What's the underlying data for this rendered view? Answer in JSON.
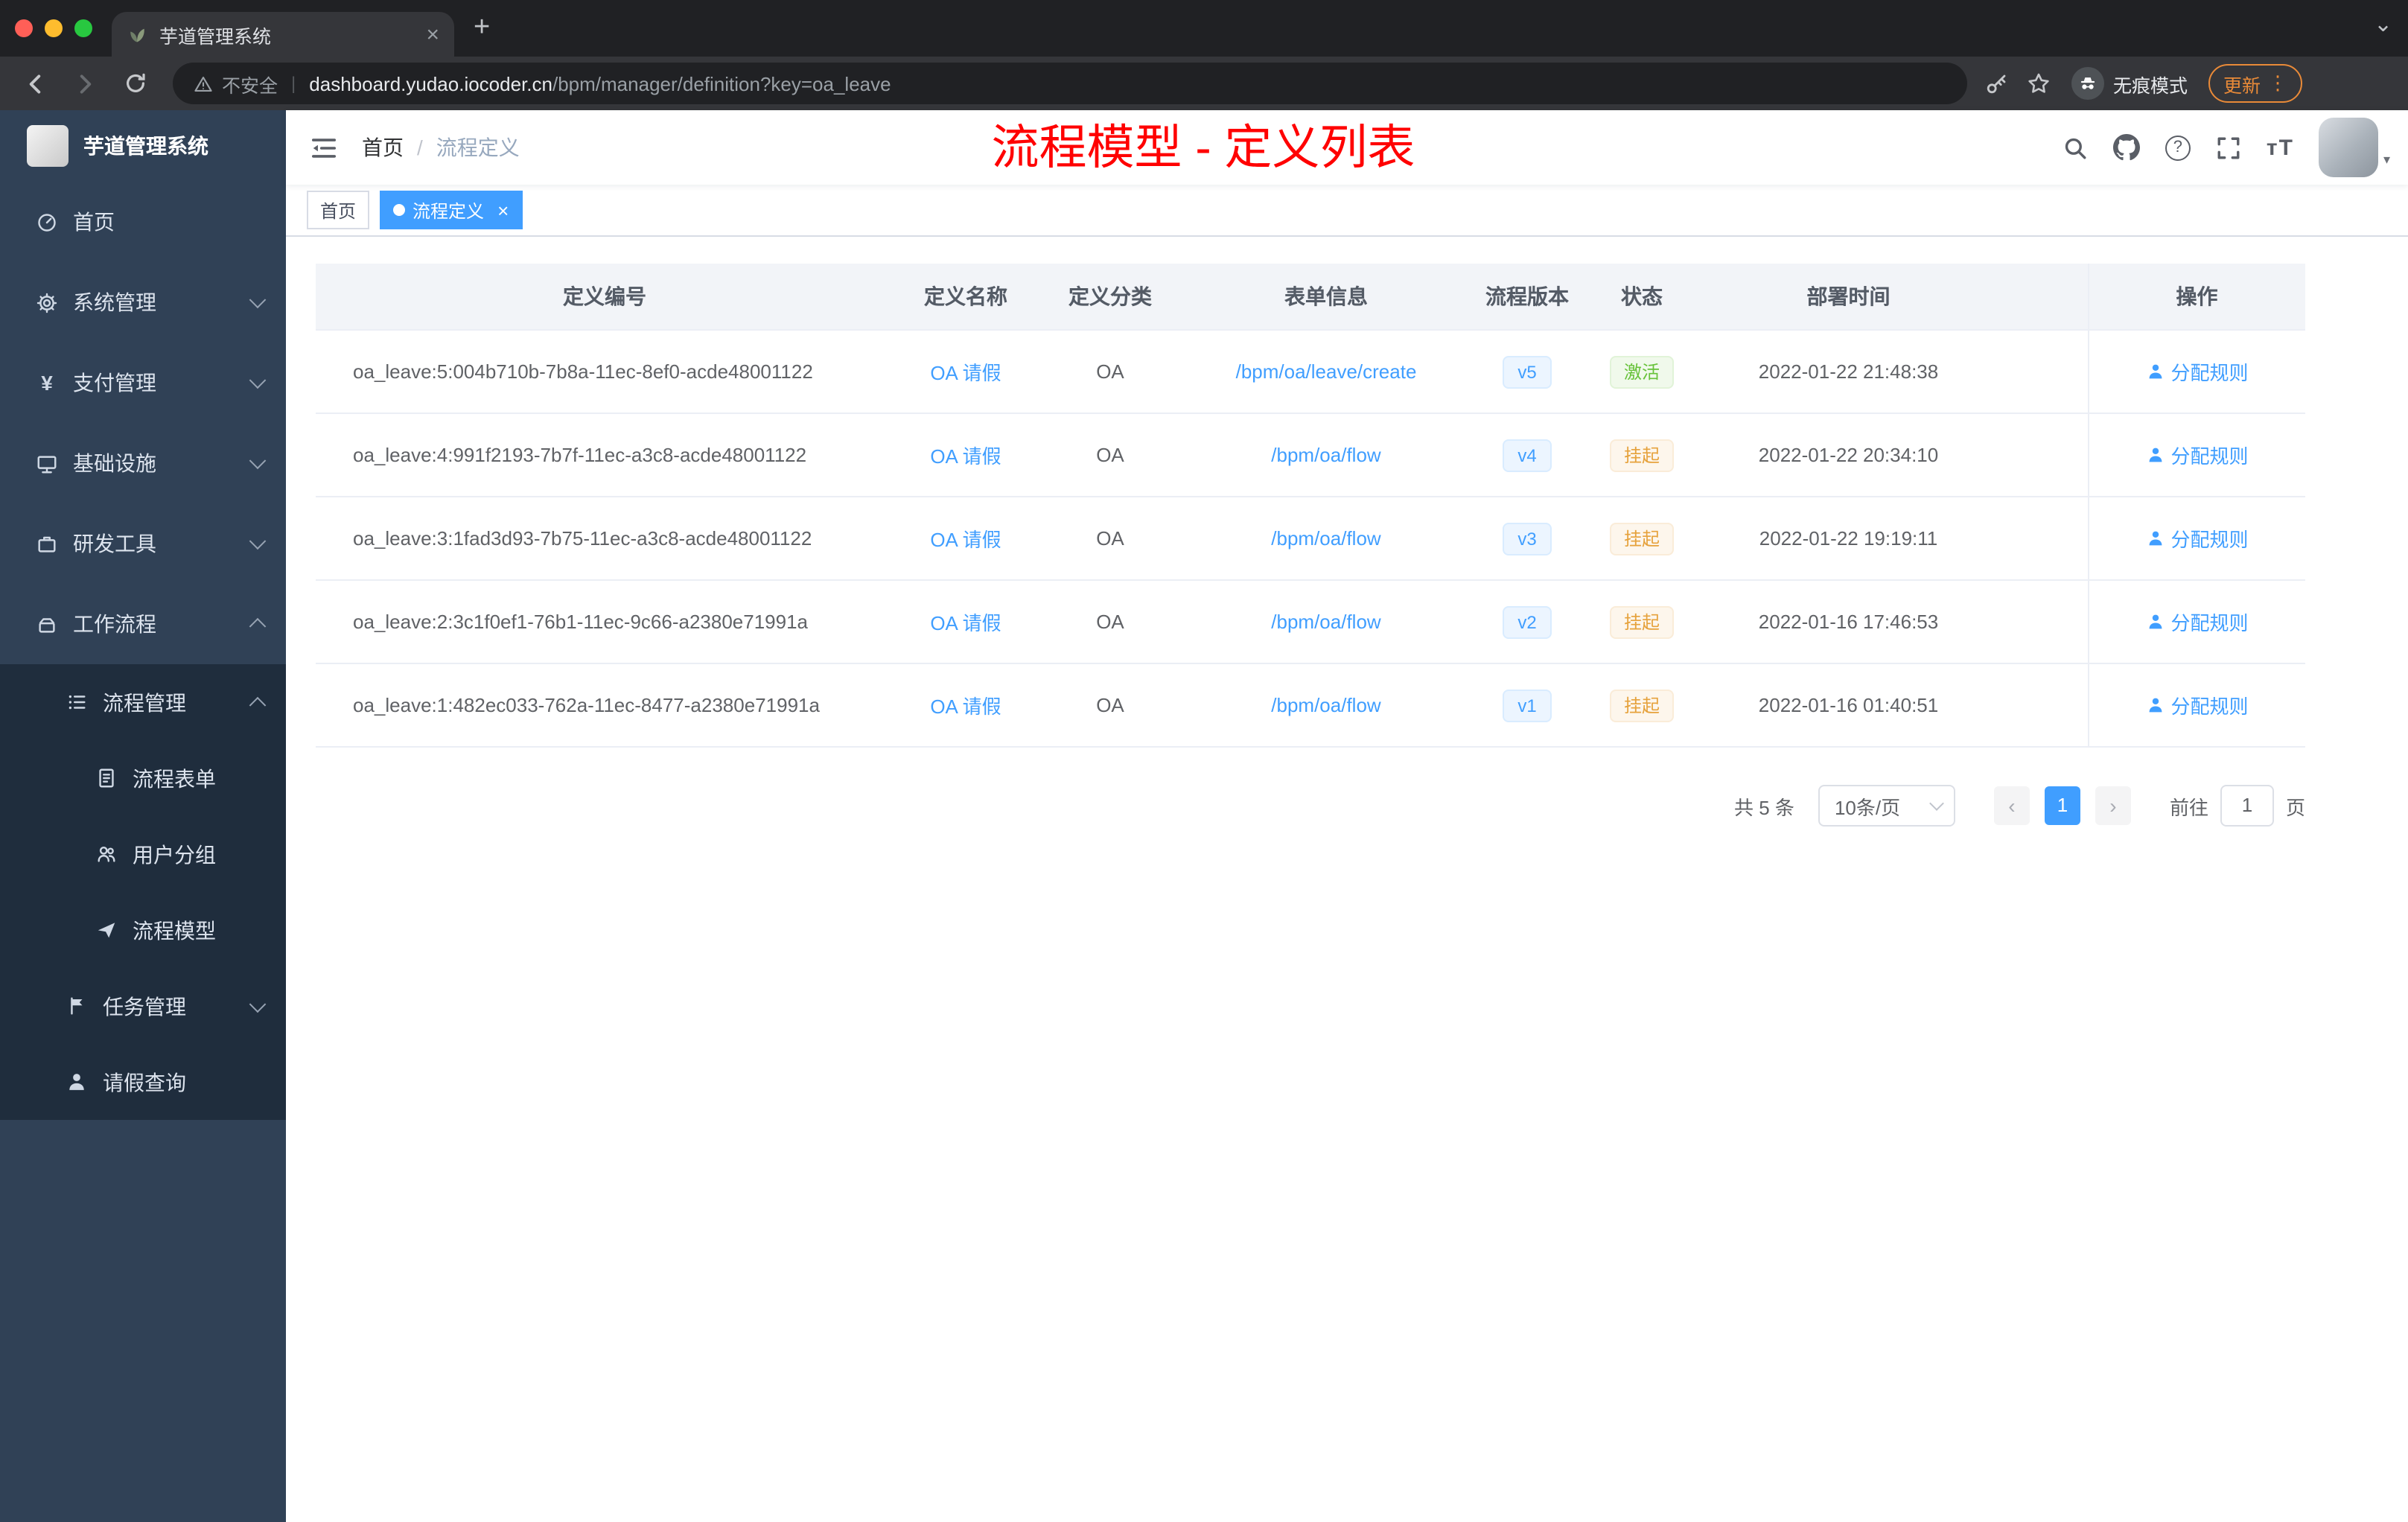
{
  "colors": {
    "accent": "#409eff",
    "title_red": "#ff0000",
    "success": "#67c23a",
    "warning": "#e6a23c",
    "sidebar_bg": "#304156"
  },
  "icons": {
    "close": "×",
    "plus": "+",
    "caret_down": "⌄",
    "pipe": "|",
    "kebab": "⋮",
    "prev": "‹",
    "next": "›",
    "question": "?",
    "yen": "¥",
    "font_size": "тT",
    "avatar_caret": "▾"
  },
  "browser": {
    "tab": {
      "title": "芋道管理系统"
    },
    "toolbar": {
      "security_label": "不安全",
      "url_domain": "dashboard.yudao.iocoder.cn",
      "url_path": "/bpm/manager/definition?key=oa_leave",
      "incognito_label": "无痕模式",
      "update_label": "更新"
    }
  },
  "sidebar": {
    "logo_title": "芋道管理系统",
    "items": [
      {
        "label": "首页",
        "icon": "dashboard-icon"
      },
      {
        "label": "系统管理",
        "icon": "gear-icon"
      },
      {
        "label": "支付管理",
        "icon": "payment-icon"
      },
      {
        "label": "基础设施",
        "icon": "infrastructure-icon"
      },
      {
        "label": "研发工具",
        "icon": "devtools-icon"
      },
      {
        "label": "工作流程",
        "icon": "workflow-icon"
      },
      {
        "label": "流程管理",
        "icon": "process-manage-icon"
      },
      {
        "label": "流程表单",
        "icon": "form-icon"
      },
      {
        "label": "用户分组",
        "icon": "user-group-icon"
      },
      {
        "label": "流程模型",
        "icon": "model-icon"
      },
      {
        "label": "任务管理",
        "icon": "task-icon"
      },
      {
        "label": "请假查询",
        "icon": "leave-query-icon"
      }
    ]
  },
  "header": {
    "breadcrumb": [
      "首页",
      "流程定义"
    ],
    "breadcrumb_separator": "/",
    "page_title": "流程模型 - 定义列表"
  },
  "tags": [
    {
      "label": "首页"
    },
    {
      "label": "流程定义"
    }
  ],
  "table": {
    "columns": [
      "定义编号",
      "定义名称",
      "定义分类",
      "表单信息",
      "流程版本",
      "状态",
      "部署时间",
      "操作"
    ],
    "rows": [
      {
        "id": "oa_leave:5:004b710b-7b8a-11ec-8ef0-acde48001122",
        "name": "OA 请假",
        "category": "OA",
        "form": "/bpm/oa/leave/create",
        "version": "v5",
        "status": "激活",
        "status_type": "success",
        "deploy_time": "2022-01-22 21:48:38",
        "action": "分配规则"
      },
      {
        "id": "oa_leave:4:991f2193-7b7f-11ec-a3c8-acde48001122",
        "name": "OA 请假",
        "category": "OA",
        "form": "/bpm/oa/flow",
        "version": "v4",
        "status": "挂起",
        "status_type": "warning",
        "deploy_time": "2022-01-22 20:34:10",
        "action": "分配规则"
      },
      {
        "id": "oa_leave:3:1fad3d93-7b75-11ec-a3c8-acde48001122",
        "name": "OA 请假",
        "category": "OA",
        "form": "/bpm/oa/flow",
        "version": "v3",
        "status": "挂起",
        "status_type": "warning",
        "deploy_time": "2022-01-22 19:19:11",
        "action": "分配规则"
      },
      {
        "id": "oa_leave:2:3c1f0ef1-76b1-11ec-9c66-a2380e71991a",
        "name": "OA 请假",
        "category": "OA",
        "form": "/bpm/oa/flow",
        "version": "v2",
        "status": "挂起",
        "status_type": "warning",
        "deploy_time": "2022-01-16 17:46:53",
        "action": "分配规则"
      },
      {
        "id": "oa_leave:1:482ec033-762a-11ec-8477-a2380e71991a",
        "name": "OA 请假",
        "category": "OA",
        "form": "/bpm/oa/flow",
        "version": "v1",
        "status": "挂起",
        "status_type": "warning",
        "deploy_time": "2022-01-16 01:40:51",
        "action": "分配规则"
      }
    ]
  },
  "pagination": {
    "total_label": "共 5 条",
    "page_size": "10条/页",
    "current_page": "1",
    "goto_label": "前往",
    "goto_value": "1",
    "page_unit": "页"
  }
}
